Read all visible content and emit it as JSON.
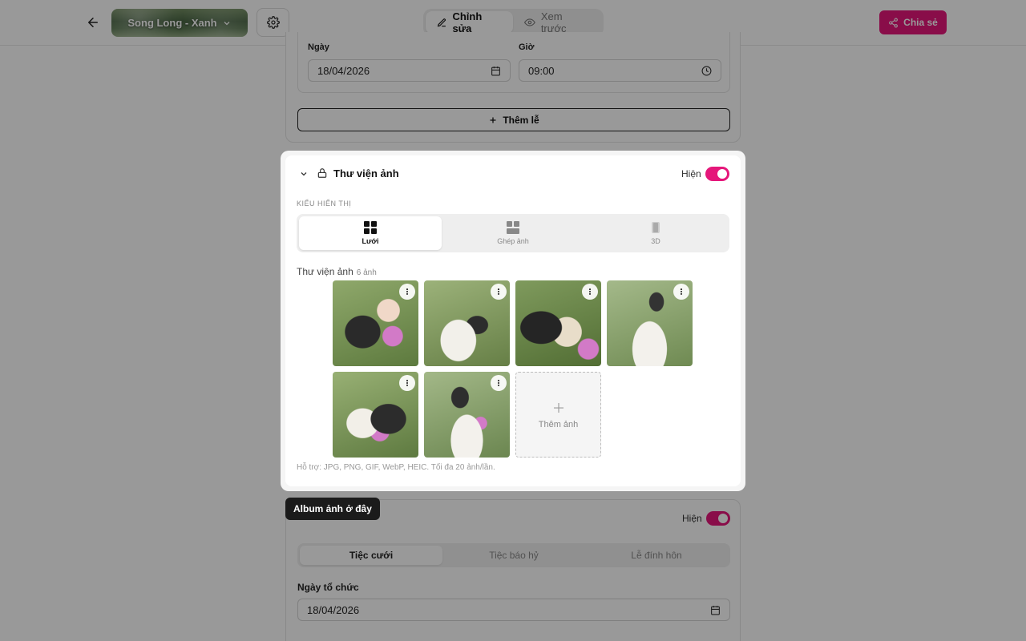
{
  "header": {
    "theme_name": "Song Long - Xanh",
    "mode_edit": "Chỉnh sửa",
    "mode_preview": "Xem trước",
    "share_label": "Chia sẻ"
  },
  "ceremony": {
    "date_label": "Ngày",
    "date_value": "18/04/2026",
    "time_label": "Giờ",
    "time_value": "09:00",
    "add_label": "Thêm lễ"
  },
  "gallery": {
    "title": "Thư viện ảnh",
    "visible_label": "Hiện",
    "visible": true,
    "display_label": "KIỂU HIỂN THỊ",
    "layouts": [
      {
        "label": "Lưới",
        "icon": "grid-icon",
        "selected": true
      },
      {
        "label": "Ghép ảnh",
        "icon": "collage-icon",
        "selected": false
      },
      {
        "label": "3D",
        "icon": "3d-icon",
        "selected": false
      }
    ],
    "library_label": "Thư viện ảnh",
    "count_label": "6 ảnh",
    "add_photo_label": "Thêm ảnh",
    "hint": "Hỗ trợ: JPG, PNG, GIF, WebP, HEIC. Tối đa 20 ảnh/lần.",
    "photos": [
      "couple-portrait",
      "seated-couple",
      "embrace",
      "veil-standing",
      "bouquet-pair",
      "full-length"
    ]
  },
  "tooltip": "Album ảnh ở đây",
  "party": {
    "visible_label": "Hiện",
    "tabs": [
      "Tiệc cưới",
      "Tiệc báo hỷ",
      "Lễ đính hôn"
    ],
    "date_label": "Ngày tổ chức",
    "date_value": "18/04/2026"
  },
  "colors": {
    "accent": "#e5177a",
    "overlay": "rgba(0,0,0,0.40)"
  }
}
